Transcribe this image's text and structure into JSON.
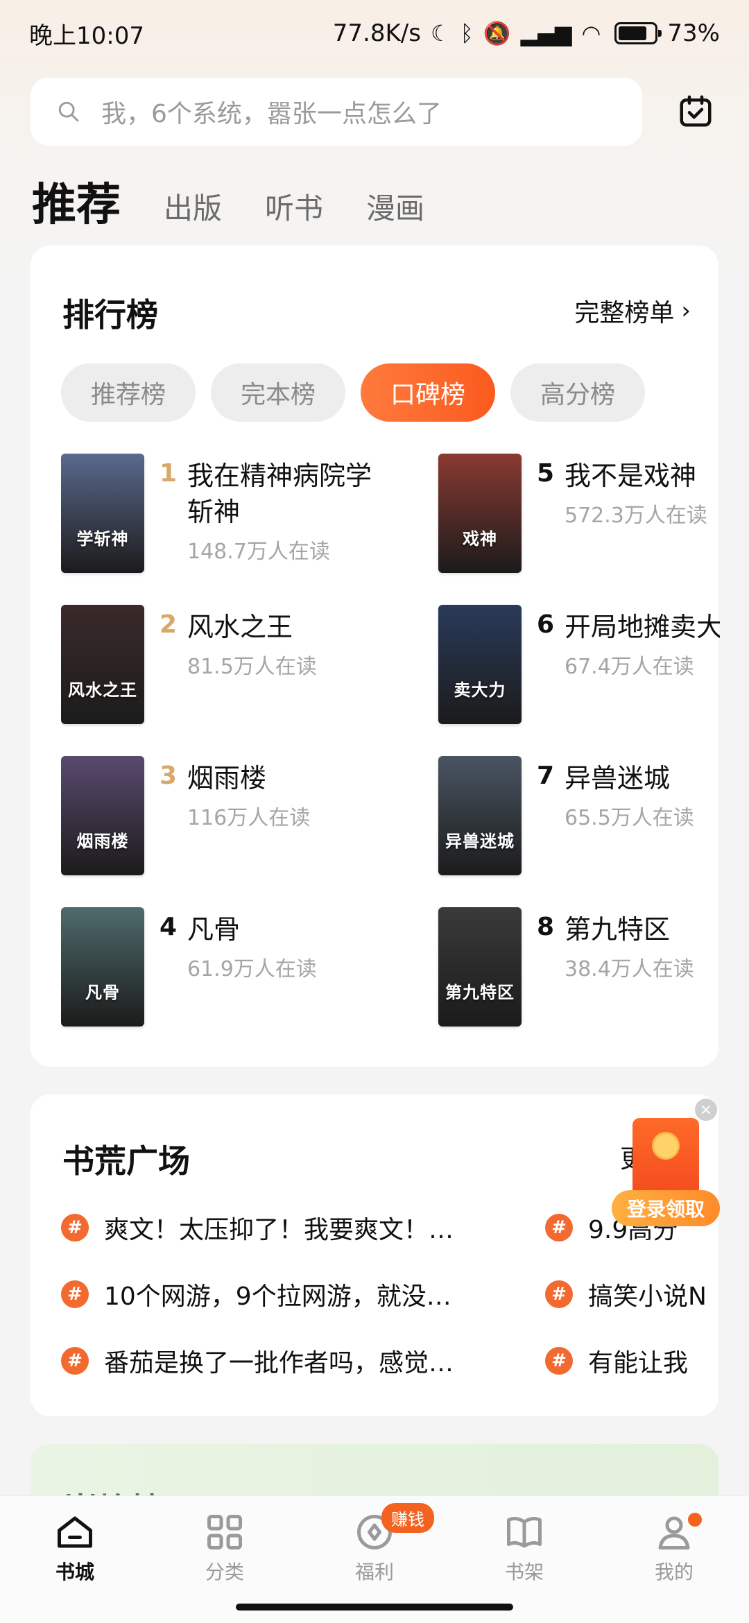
{
  "status_bar": {
    "time": "晚上10:07",
    "speed": "77.8K/s",
    "battery": "73%"
  },
  "search": {
    "placeholder": "我，6个系统，嚣张一点怎么了"
  },
  "tabs": {
    "active": "推荐",
    "items": [
      "出版",
      "听书",
      "漫画"
    ]
  },
  "ranking": {
    "title": "排行榜",
    "full_list": "完整榜单",
    "pills": [
      "推荐榜",
      "完本榜",
      "口碑榜",
      "高分榜"
    ],
    "active_pill": 2,
    "books": [
      {
        "rank": "1",
        "title": "我在精神病院学斩神",
        "readers": "148.7万人在读",
        "cover_text": "学斩神",
        "cover_color": "#5a6a8e"
      },
      {
        "rank": "2",
        "title": "风水之王",
        "readers": "81.5万人在读",
        "cover_text": "风水之王",
        "cover_color": "#3b2a2a"
      },
      {
        "rank": "3",
        "title": "烟雨楼",
        "readers": "116万人在读",
        "cover_text": "烟雨楼",
        "cover_color": "#5a4a6e"
      },
      {
        "rank": "4",
        "title": "凡骨",
        "readers": "61.9万人在读",
        "cover_text": "凡骨",
        "cover_color": "#4f6b6b"
      },
      {
        "rank": "5",
        "title": "我不是戏神",
        "readers": "572.3万人在读",
        "cover_text": "戏神",
        "cover_color": "#8a3a32"
      },
      {
        "rank": "6",
        "title": "开局地摊卖大力",
        "readers": "67.4万人在读",
        "cover_text": "卖大力",
        "cover_color": "#2a3a5a"
      },
      {
        "rank": "7",
        "title": "异兽迷城",
        "readers": "65.5万人在读",
        "cover_text": "异兽迷城",
        "cover_color": "#4a5562"
      },
      {
        "rank": "8",
        "title": "第九特区",
        "readers": "38.4万人在读",
        "cover_text": "第九特区",
        "cover_color": "#3a3a3a"
      }
    ]
  },
  "square": {
    "title": "书荒广场",
    "more": "更",
    "topics": [
      "爽文！太压抑了！我要爽文！…",
      "10个网游，9个拉网游，就没…",
      "番茄是换了一批作者吗，感觉…",
      "9.9高分",
      "搞笑小说N",
      "有能让我"
    ]
  },
  "floating_promo": {
    "label": "登录领取"
  },
  "next_section": {
    "title": "巅峰榜"
  },
  "bottom_nav": {
    "items": [
      {
        "label": "书城",
        "icon": "home-icon"
      },
      {
        "label": "分类",
        "icon": "grid-icon"
      },
      {
        "label": "福利",
        "icon": "coin-icon"
      },
      {
        "label": "书架",
        "icon": "book-icon"
      },
      {
        "label": "我的",
        "icon": "profile-icon"
      }
    ],
    "earn_badge": "赚钱"
  },
  "colors": {
    "accent": "#f4621f",
    "rank_gold": "#d8a86b"
  }
}
